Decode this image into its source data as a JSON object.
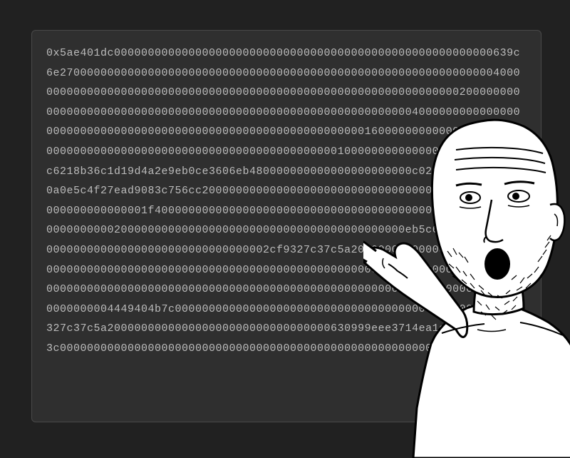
{
  "hex_content": "0x5ae401dc00000000000000000000000000000000000000000000000000000000639c6e2700000000000000000000000000000000000000000000000000000000000000400000000000000000000000000000000000000000000000000000000000000002000000000000000000000000000000000000000000000000000000000000004000000000000000000000000000000000000000000000000000000000000001600000000000000000000000000000000000000000000000000000000000000001000000000000000000a0b86991c6218b36c1d19d4a2e9eb0ce3606eb480000000000000000000000c02aaa39b223fe8d0a0e5c4f27ead9083c756cc20000000000000000000000000000000000000000000000000000000000001f40000000000000000000000000000000000000000000000000000000000000002000000000000000000000000000000000000000000eb5c62d0000000000000000000000000000000000000000002cf9327c37c5a2000000000000000000000000000000000000000000000000000000000000000000000000000000000000000000000000000000000000000000000000000000000000000000000000000000000000000000000000000004449404b7c000000000000000000000000000000000000000000000002cf9327c37c5a200000000000000000000000000000000630999eee3714ea1e513f31afb113c00000000000000000000000000000000000000000000000000000000000000",
  "meme_character": "pointing-wojak"
}
